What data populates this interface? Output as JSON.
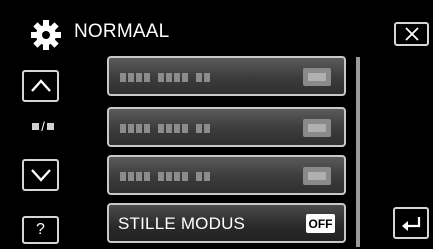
{
  "header": {
    "title": "NORMAAL",
    "icon": "gear-icon"
  },
  "nav": {
    "page_indicator": "/",
    "help_label": "?"
  },
  "menu": {
    "items": [
      {
        "label": "",
        "state": ""
      },
      {
        "label": "",
        "state": ""
      },
      {
        "label": "",
        "state": ""
      },
      {
        "label": "STILLE MODUS",
        "state": "OFF"
      }
    ]
  }
}
